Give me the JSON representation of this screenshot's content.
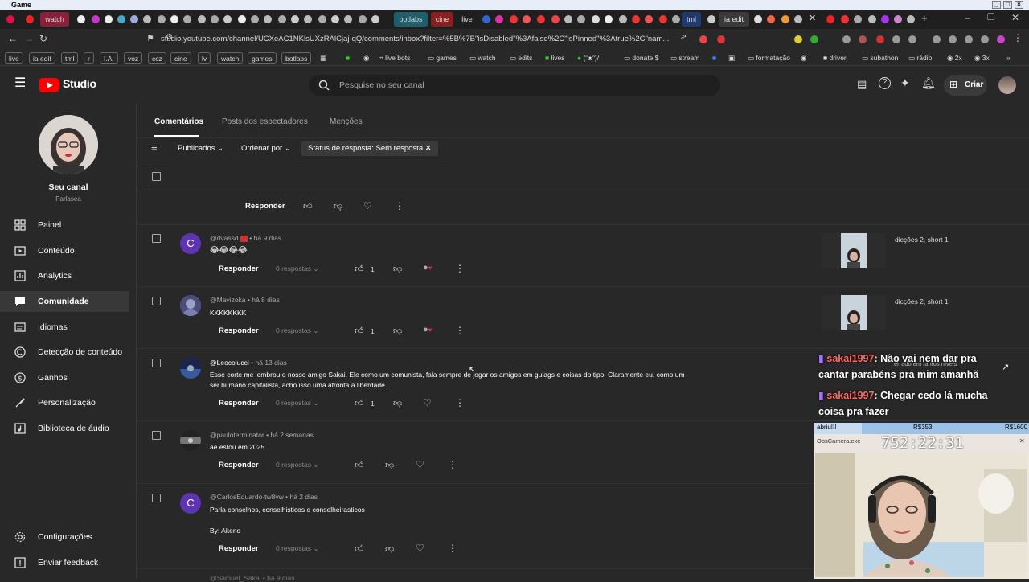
{
  "window": {
    "title": "Game"
  },
  "tabs": [
    {
      "label": "watch",
      "color": "#8b1f3a"
    },
    {
      "label": "botlabs",
      "color": "#1e5f6e"
    },
    {
      "label": "cine",
      "color": "#8b1f1f"
    },
    {
      "label": "live",
      "color": "#1e1e1e"
    },
    {
      "label": "tml",
      "color": "#1e3a6e"
    },
    {
      "label": "ia edit",
      "color": "#3a3a3a"
    }
  ],
  "addressbar": {
    "url": "studio.youtube.com/channel/UCXeAC1NKlsUXzRAlCjaj-qQ/comments/inbox?filter=%5B%7B\"isDisabled\"%3Afalse%2C\"isPinned\"%3Atrue%2C\"nam..."
  },
  "bookmarks": [
    "live",
    "ia edit",
    "tml",
    "r",
    "I.A.",
    "voz",
    "ccz",
    "cine",
    "lv",
    "watch",
    "games",
    "botlabs",
    "live bots",
    "games",
    "watch",
    "edits",
    "lives",
    "(ᵔᴥᵔ)/",
    "donate $",
    "stream",
    "formatação",
    "driver",
    "subathon",
    "rádio",
    "2x",
    "3x"
  ],
  "header": {
    "studio_label": "Studio",
    "search_placeholder": "Pesquise no seu canal",
    "create_label": "Criar"
  },
  "channel": {
    "title": "Seu canal",
    "name": "Parlasea"
  },
  "nav": [
    {
      "label": "Painel",
      "icon": "dashboard-icon"
    },
    {
      "label": "Conteúdo",
      "icon": "content-icon"
    },
    {
      "label": "Analytics",
      "icon": "analytics-icon"
    },
    {
      "label": "Comunidade",
      "icon": "community-icon"
    },
    {
      "label": "Idiomas",
      "icon": "languages-icon"
    },
    {
      "label": "Detecção de conteúdo",
      "icon": "copyright-icon"
    },
    {
      "label": "Ganhos",
      "icon": "earn-icon"
    },
    {
      "label": "Personalização",
      "icon": "customization-icon"
    },
    {
      "label": "Biblioteca de áudio",
      "icon": "audio-library-icon"
    }
  ],
  "nav_bottom": [
    {
      "label": "Configurações",
      "icon": "settings-icon"
    },
    {
      "label": "Enviar feedback",
      "icon": "feedback-icon"
    }
  ],
  "subtabs": [
    "Comentários",
    "Posts dos espectadores",
    "Menções"
  ],
  "filters": {
    "published": "Publicados",
    "sort": "Ordenar por",
    "status": "Status de resposta: Sem resposta"
  },
  "reply_label": "Responder",
  "comments": [
    {
      "author": "@dvassd",
      "time": "há 9 dias",
      "text": "😂😂😂😂",
      "replies": "0 respostas",
      "likes": "1",
      "video": "dicções 2, short 1",
      "avatar_letter": "C",
      "avatar_color": "#5e35b1"
    },
    {
      "author": "@Mavizoka",
      "time": "há 8 dias",
      "text": "KKKKKKKK",
      "replies": "0 respostas",
      "likes": "1",
      "video": "dicções 2, short 1",
      "avatar_color": "#5c6bc0"
    },
    {
      "author": "@Leocolucci",
      "time": "há 13 dias",
      "text": "Esse corte me lembrou o nosso amigo Sakai. Ele como um comunista, fala sempre de jogar os amigos em gulags e coisas do tipo. Claramente eu, como um",
      "text2": "ser humano capitalista, acho isso uma afronta a liberdade.",
      "replies": "0 respostas",
      "likes": "1",
      "avatar_color": "#2a3a6e"
    },
    {
      "author": "@pauloterminator",
      "time": "há 2 semanas",
      "text": "ae estou em 2025",
      "replies": "0 respostas",
      "avatar_color": "#555"
    },
    {
      "author": "@CarlosEduardo-tw8vw",
      "time": "há 2 dias",
      "text": "Parla conselhos, conselhisticos e conselheirasticos",
      "text2": "By: Akeno",
      "replies": "0 respostas",
      "avatar_letter": "C",
      "avatar_color": "#5e35b1"
    }
  ],
  "next_author": "@Samuel_Sakai",
  "next_time": "há 9 dias",
  "overlay": {
    "chat": [
      {
        "user": "sakai1997",
        "msg": ": Não vai nem dar pra",
        "cont": "cantar parabéns pra mim amanhã"
      },
      {
        "user": "sakai1997",
        "msg": ": Chegar cedo lá mucha",
        "cont": "coisa pra fazer"
      }
    ],
    "overlay_note": "errado em tantos níveis",
    "goal_label": "abriu!!!",
    "goal_mid": "R$353",
    "goal_end": "R$1600",
    "timer": "752:22:31",
    "cam_title": "ObsCamera.exe"
  }
}
